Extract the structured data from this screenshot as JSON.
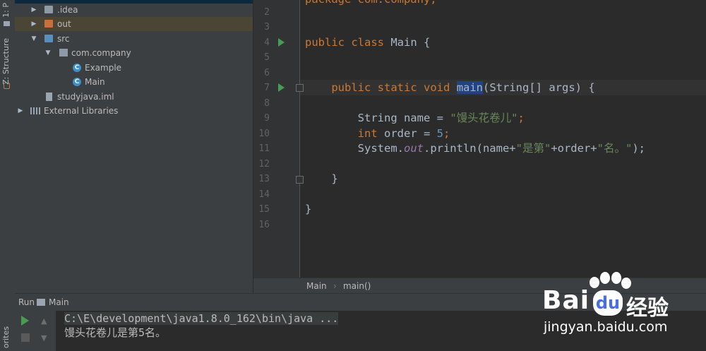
{
  "left_tabs": {
    "project": "1: P",
    "structure": "Z: Structure",
    "favorites": "orites"
  },
  "tree": [
    {
      "label": ".idea",
      "icon": "folder-icon"
    },
    {
      "label": "out",
      "icon": "folder-orange-icon"
    },
    {
      "label": "src",
      "icon": "source-folder-icon"
    },
    {
      "label": "com.company",
      "icon": "package-icon"
    },
    {
      "label": "Example",
      "icon": "java-class-icon"
    },
    {
      "label": "Main",
      "icon": "java-class-icon"
    },
    {
      "label": "studyjava.iml",
      "icon": "module-file-icon"
    },
    {
      "label": "External Libraries",
      "icon": "libraries-icon"
    }
  ],
  "editor": {
    "line_numbers": [
      "2",
      "3",
      "4",
      "5",
      "6",
      "7",
      "8",
      "9",
      "10",
      "11",
      "12",
      "13",
      "14",
      "15",
      "16"
    ],
    "lines": {
      "l2": "package com.company;",
      "kw_public": "public",
      "kw_class": "class",
      "kw_static": "static",
      "kw_void": "void",
      "kw_int": "int",
      "main_class": " Main {",
      "method_name": "main",
      "method_params": "(String[] args) {",
      "string_type": "String name = ",
      "name_value": "\"馒头花卷儿\"",
      "semicolon": ";",
      "order_decl": " order = ",
      "order_value": "5",
      "println_prefix": "System.",
      "println_out": "out",
      "println_mid": ".println(name+",
      "str_rank": "\"是第\"",
      "println_mid2": "+order+",
      "str_ming": "\"名。\"",
      "println_end": ");",
      "brace_close": "}"
    }
  },
  "breadcrumb": {
    "class": "Main",
    "sep": "›",
    "method": "main()"
  },
  "run_panel": {
    "run_label": "Run",
    "config": "Main",
    "command": "C:\\E\\development\\java1.8.0_162\\bin\\java ...",
    "output": "馒头花卷儿是第5名。"
  },
  "watermark": {
    "brand": "Bai",
    "brand2": "du",
    "cn": "经验",
    "site": "jingyan.baidu.com"
  }
}
